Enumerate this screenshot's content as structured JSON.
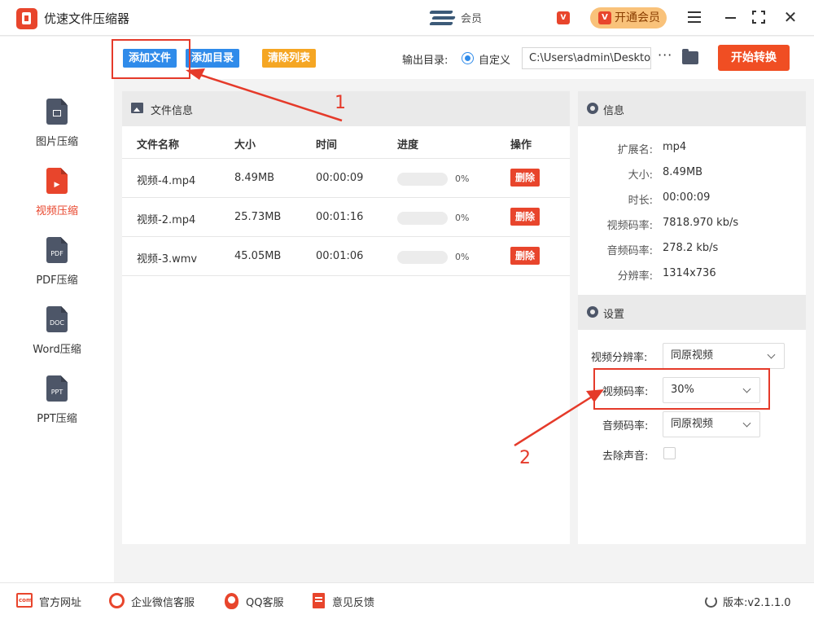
{
  "app": {
    "title": "优速文件压缩器"
  },
  "header": {
    "user_name": "会员",
    "vip_mini": "V",
    "vip_button": "开通会员",
    "vip_icon": "V",
    "close_glyph": "✕"
  },
  "sidebar": {
    "items": [
      {
        "label": "图片压缩",
        "icon": "image-file-icon",
        "doc_text": "",
        "active": false
      },
      {
        "label": "视频压缩",
        "icon": "video-file-icon",
        "doc_text": "▶",
        "active": true
      },
      {
        "label": "PDF压缩",
        "icon": "pdf-file-icon",
        "doc_text": "PDF",
        "active": false
      },
      {
        "label": "Word压缩",
        "icon": "word-file-icon",
        "doc_text": "DOC",
        "active": false
      },
      {
        "label": "PPT压缩",
        "icon": "ppt-file-icon",
        "doc_text": "PPT",
        "active": false
      }
    ]
  },
  "toolbar": {
    "add_file": "添加文件",
    "add_dir": "添加目录",
    "clear_list": "清除列表",
    "output_label": "输出目录:",
    "custom_label": "自定义",
    "output_path": "C:\\Users\\admin\\Desktop",
    "more": "···",
    "start": "开始转换"
  },
  "file_panel": {
    "title": "文件信息",
    "columns": [
      "文件名称",
      "大小",
      "时间",
      "进度",
      "操作"
    ],
    "rows": [
      {
        "name": "视频-4.mp4",
        "size": "8.49MB",
        "time": "00:00:09",
        "progress_text": "0%",
        "progress": 0,
        "action": "删除"
      },
      {
        "name": "视频-2.mp4",
        "size": "25.73MB",
        "time": "00:01:16",
        "progress_text": "0%",
        "progress": 0,
        "action": "删除"
      },
      {
        "name": "视频-3.wmv",
        "size": "45.05MB",
        "time": "00:01:06",
        "progress_text": "0%",
        "progress": 0,
        "action": "删除"
      }
    ]
  },
  "info_panel": {
    "title": "信息",
    "fields": [
      {
        "key": "扩展名:",
        "value": "mp4"
      },
      {
        "key": "大小:",
        "value": "8.49MB"
      },
      {
        "key": "时长:",
        "value": "00:00:09"
      },
      {
        "key": "视频码率:",
        "value": "7818.970 kb/s"
      },
      {
        "key": "音频码率:",
        "value": "278.2 kb/s"
      },
      {
        "key": "分辨率:",
        "value": "1314x736"
      }
    ]
  },
  "settings": {
    "title": "设置",
    "video_resolution_label": "视频分辨率:",
    "video_resolution_value": "同原视频",
    "video_bitrate_label": "视频码率:",
    "video_bitrate_value": "30%",
    "audio_bitrate_label": "音频码率:",
    "audio_bitrate_value": "同原视频",
    "remove_audio_label": "去除声音:",
    "remove_audio_checked": false
  },
  "annotations": {
    "step1": "1",
    "step2": "2"
  },
  "footer": {
    "website": "官方网址",
    "website_icon_text": "com",
    "wechat": "企业微信客服",
    "qq": "QQ客服",
    "feedback": "意见反馈",
    "version": "版本:v2.1.1.0"
  },
  "colors": {
    "accent": "#e8452c",
    "primary_blue": "#2f8bea",
    "orange": "#f5a623",
    "start": "#f04e23",
    "annotation": "#e53a2a"
  }
}
